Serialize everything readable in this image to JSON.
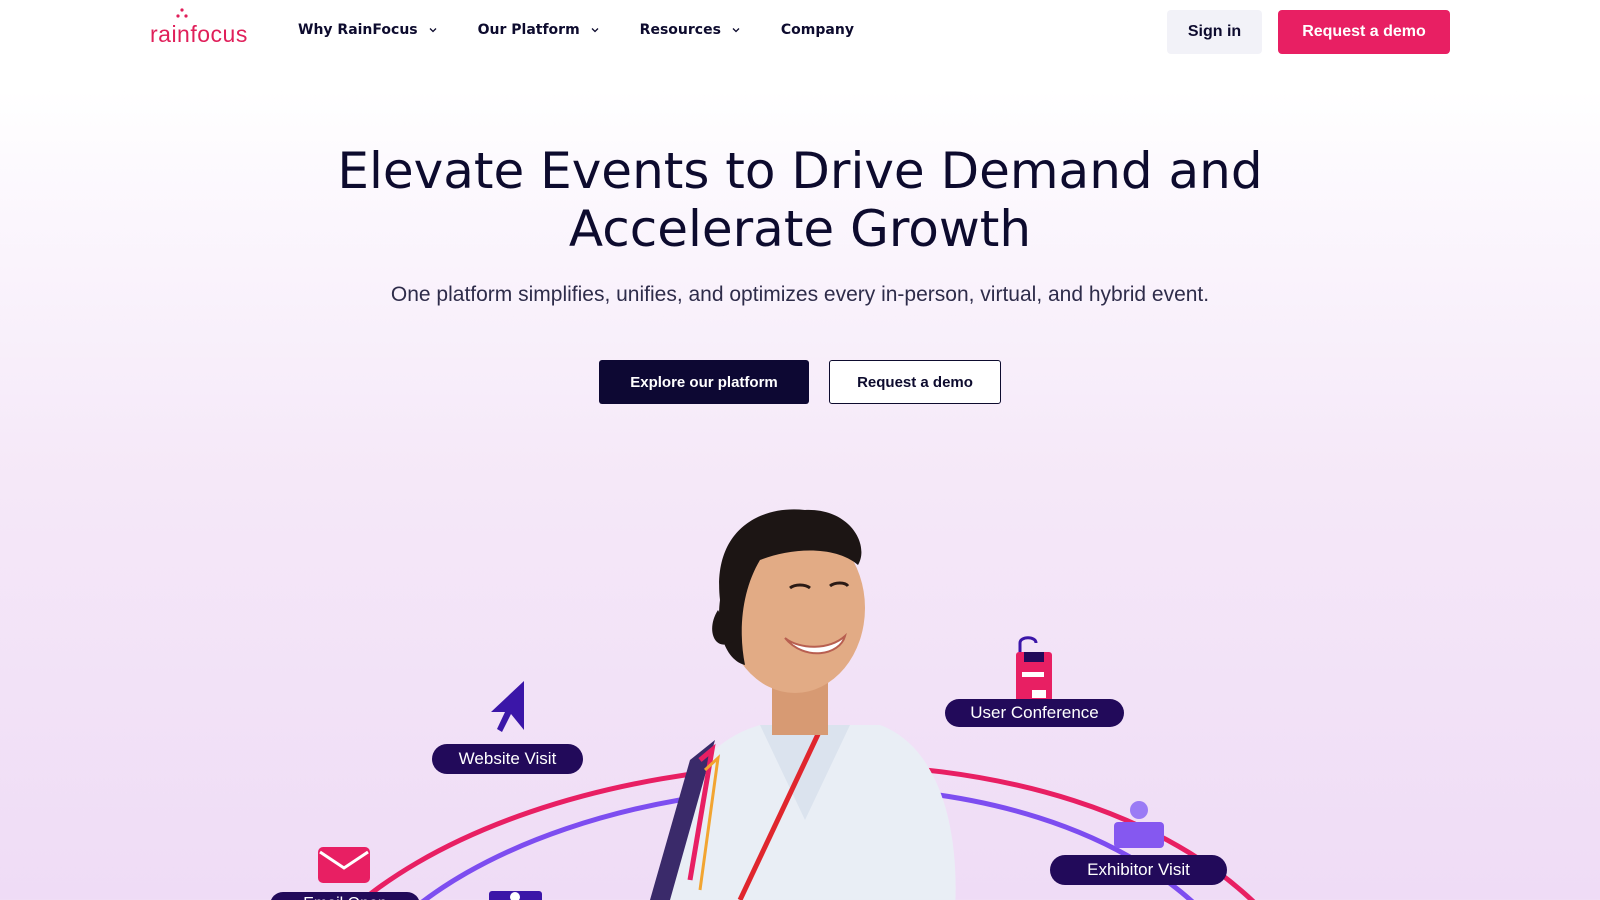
{
  "brand": {
    "name": "rainfocus",
    "accent": "#e81f63",
    "navy": "#0d0833"
  },
  "nav": {
    "items": [
      {
        "label": "Why RainFocus",
        "has_dropdown": true
      },
      {
        "label": "Our Platform",
        "has_dropdown": true
      },
      {
        "label": "Resources",
        "has_dropdown": true
      },
      {
        "label": "Company",
        "has_dropdown": false
      }
    ],
    "sign_in": "Sign in",
    "request_demo": "Request a demo"
  },
  "hero": {
    "title_line1": "Elevate Events to Drive Demand and",
    "title_line2": "Accelerate Growth",
    "subtitle": "One platform simplifies, unifies, and optimizes every in-person, virtual, and hybrid event.",
    "primary_cta": "Explore our platform",
    "secondary_cta": "Request a demo"
  },
  "journey": {
    "labels": {
      "website_visit": "Website Visit",
      "user_conference": "User Conference",
      "exhibitor_visit": "Exhibitor Visit",
      "email_open": "Email Open"
    },
    "icons": [
      "cursor-icon",
      "badge-icon",
      "person-icon",
      "envelope-icon"
    ]
  }
}
